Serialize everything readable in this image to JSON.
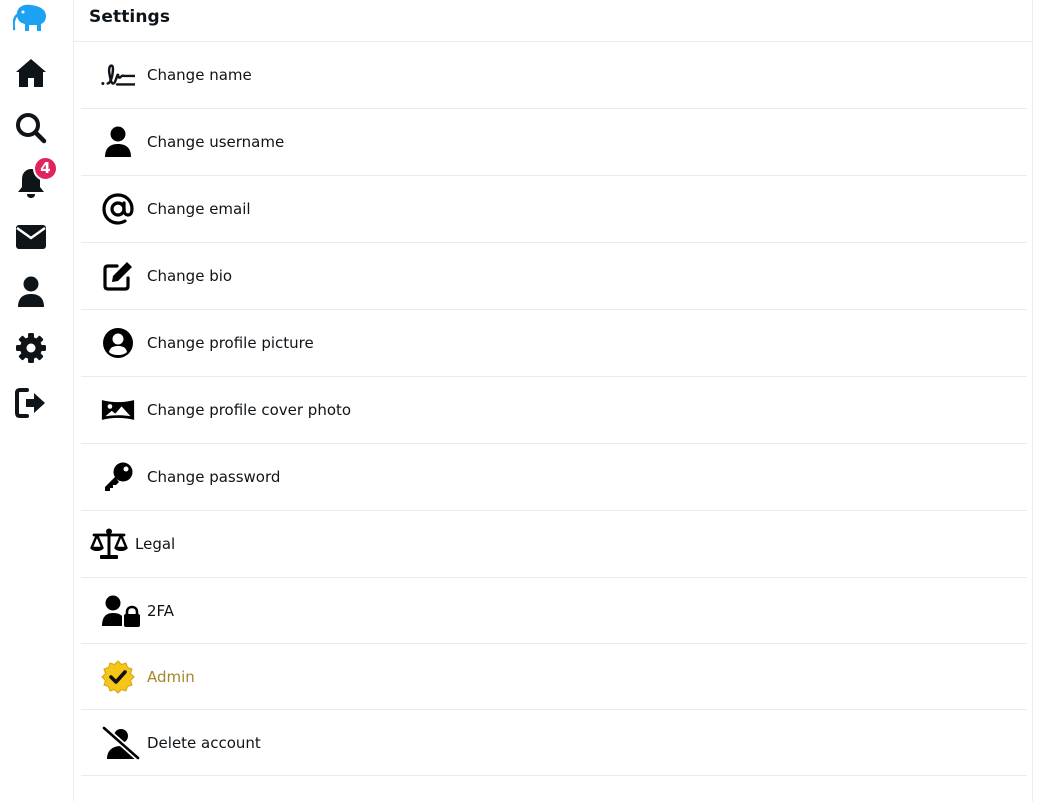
{
  "sidebar": {
    "items": [
      {
        "icon": "kiwi-logo-icon"
      },
      {
        "icon": "home-icon"
      },
      {
        "icon": "search-icon"
      },
      {
        "icon": "bell-icon",
        "badge": "4"
      },
      {
        "icon": "envelope-icon"
      },
      {
        "icon": "user-icon"
      },
      {
        "icon": "gear-icon"
      },
      {
        "icon": "sign-out-icon"
      }
    ]
  },
  "header": {
    "title": "Settings"
  },
  "settings": {
    "items": [
      {
        "label": "Change name",
        "icon": "signature-icon"
      },
      {
        "label": "Change username",
        "icon": "user-icon"
      },
      {
        "label": "Change email",
        "icon": "at-icon"
      },
      {
        "label": "Change bio",
        "icon": "edit-icon"
      },
      {
        "label": "Change profile picture",
        "icon": "user-circle-icon"
      },
      {
        "label": "Change profile cover photo",
        "icon": "panorama-icon"
      },
      {
        "label": "Change password",
        "icon": "key-icon"
      },
      {
        "label": "Legal",
        "icon": "scale-icon"
      },
      {
        "label": "2FA",
        "icon": "user-lock-icon"
      },
      {
        "label": "Admin",
        "icon": "verified-badge-icon",
        "color": "#a6862c"
      },
      {
        "label": "Delete account",
        "icon": "user-slash-icon"
      }
    ]
  },
  "colors": {
    "brand": "#1da1f2",
    "badge": "#e0245e",
    "admin": "#a6862c",
    "border": "#e6ecf0"
  }
}
